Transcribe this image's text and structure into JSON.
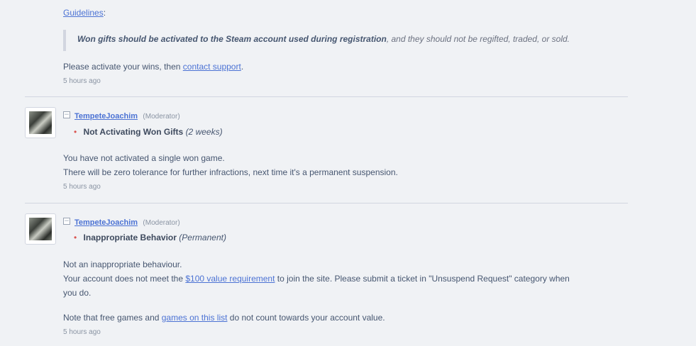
{
  "top": {
    "guidelines_link": "Guidelines",
    "guidelines_colon": ":",
    "quote_bold": "Won gifts should be activated to the Steam account used during registration",
    "quote_rest": ", and they should not be regifted, traded, or sold.",
    "line_prefix": "Please activate your wins, then ",
    "contact_link": "contact support",
    "line_suffix": ".",
    "timestamp": "5 hours ago"
  },
  "comments": [
    {
      "collapse": "−",
      "username": "TempeteJoachim",
      "role": "(Moderator)",
      "bullet": "•",
      "reason": "Not Activating Won Gifts",
      "duration": "(2 weeks)",
      "lines": [
        "You have not activated a single won game.",
        "There will be zero tolerance for further infractions, next time it's a permanent suspension."
      ],
      "timestamp": "5 hours ago"
    },
    {
      "collapse": "−",
      "username": "TempeteJoachim",
      "role": "(Moderator)",
      "bullet": "•",
      "reason": "Inappropriate Behavior",
      "duration": "(Permanent)",
      "line1": "Not an inappropriate behaviour.",
      "line2_prefix": "Your account does not meet the ",
      "value_link": "$100 value requirement",
      "line2_suffix": " to join the site. Please submit a ticket in \"Unsuspend Request\" category when",
      "line3": "you do.",
      "note_prefix": "Note that free games and ",
      "list_link": "games on this list",
      "note_suffix": " do not count towards your account value.",
      "timestamp": "5 hours ago"
    }
  ]
}
